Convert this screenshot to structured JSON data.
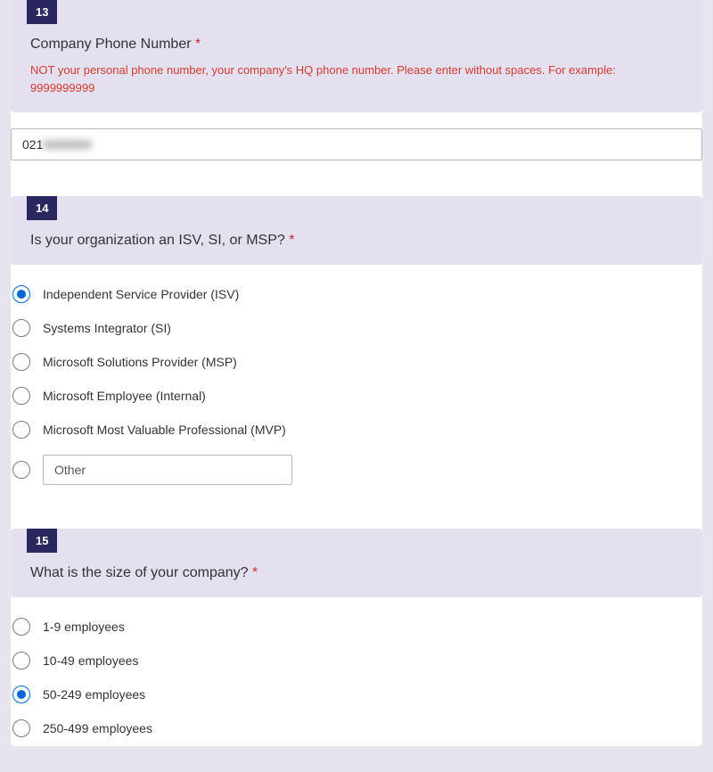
{
  "q13": {
    "number": "13",
    "title": "Company Phone Number",
    "required_marker": "*",
    "helper": "NOT your personal phone number, your company's HQ phone number. Please enter without spaces. For example: 9999999999",
    "value_prefix": "021",
    "value_hidden": "0000000"
  },
  "q14": {
    "number": "14",
    "title": "Is your organization an ISV, SI, or MSP?",
    "required_marker": "*",
    "options": [
      "Independent Service Provider (ISV)",
      "Systems Integrator (SI)",
      "Microsoft Solutions Provider (MSP)",
      "Microsoft Employee (Internal)",
      "Microsoft Most Valuable Professional (MVP)"
    ],
    "other_label": "Other",
    "selected_index": 0
  },
  "q15": {
    "number": "15",
    "title": "What is the size of your company?",
    "required_marker": "*",
    "options": [
      "1-9 employees",
      "10-49 employees",
      "50-249 employees",
      "250-499 employees"
    ],
    "selected_index": 2
  }
}
